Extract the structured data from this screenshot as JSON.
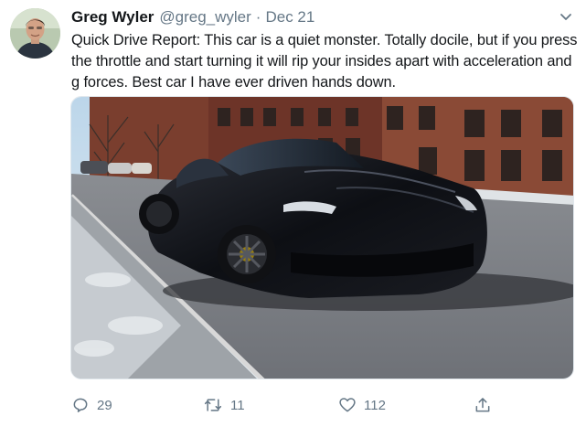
{
  "author": {
    "display_name": "Greg Wyler",
    "handle": "@greg_wyler",
    "separator": "·",
    "date": "Dec 21"
  },
  "tweet": {
    "text": "Quick Drive Report: This car is a quiet monster. Totally docile, but if you press the throttle and start turning it will rip your insides apart with acceleration and g forces. Best car I have ever driven hands down."
  },
  "media": {
    "subject": "black sports car parked on snowy city street"
  },
  "actions": {
    "replies": "29",
    "retweets": "11",
    "likes": "112"
  },
  "icons": {
    "reply": "reply-icon",
    "retweet": "retweet-icon",
    "like": "heart-icon",
    "share": "share-icon",
    "menu": "chevron-down-icon"
  },
  "colors": {
    "text": "#14171a",
    "muted": "#657786",
    "border": "#e1e8ed"
  }
}
